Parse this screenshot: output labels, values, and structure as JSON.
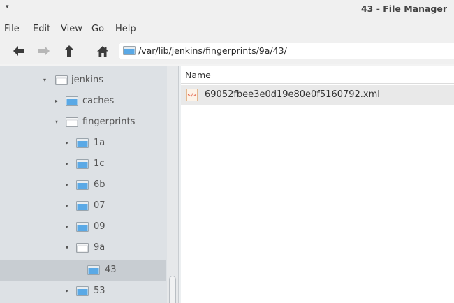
{
  "window": {
    "title": "43 - File Manager",
    "menu_button": "▾"
  },
  "menubar": {
    "items": [
      "File",
      "Edit",
      "View",
      "Go",
      "Help"
    ]
  },
  "toolbar": {
    "back_icon": "arrow-left-icon",
    "forward_icon": "arrow-right-icon",
    "up_icon": "arrow-up-icon",
    "home_icon": "home-icon",
    "location_path": "/var/lib/jenkins/fingerprints/9a/43/"
  },
  "colors": {
    "sidebar_bg": "#dde1e5",
    "selected_row": "#c8cdd2",
    "folder_blue": "#5aa9e6",
    "file_row_bg": "#e9e9e9"
  },
  "sidebar": {
    "tree": [
      {
        "label": "jenkins",
        "expander": "▾",
        "state": "expanded"
      },
      {
        "label": "caches",
        "expander": "▸",
        "state": "collapsed"
      },
      {
        "label": "fingerprints",
        "expander": "▾",
        "state": "expanded"
      },
      {
        "label": "1a",
        "expander": "▸",
        "state": "collapsed"
      },
      {
        "label": "1c",
        "expander": "▸",
        "state": "collapsed"
      },
      {
        "label": "6b",
        "expander": "▸",
        "state": "collapsed"
      },
      {
        "label": "07",
        "expander": "▸",
        "state": "collapsed"
      },
      {
        "label": "09",
        "expander": "▸",
        "state": "collapsed"
      },
      {
        "label": "9a",
        "expander": "▾",
        "state": "expanded"
      },
      {
        "label": "43",
        "expander": "",
        "state": "selected"
      },
      {
        "label": "53",
        "expander": "▸",
        "state": "collapsed"
      }
    ]
  },
  "filelist": {
    "columns": [
      "Name"
    ],
    "files": [
      {
        "name": "69052fbee3e0d19e80e0f5160792.xml",
        "icon": "xml-file-icon",
        "icon_text": "</>"
      }
    ]
  }
}
